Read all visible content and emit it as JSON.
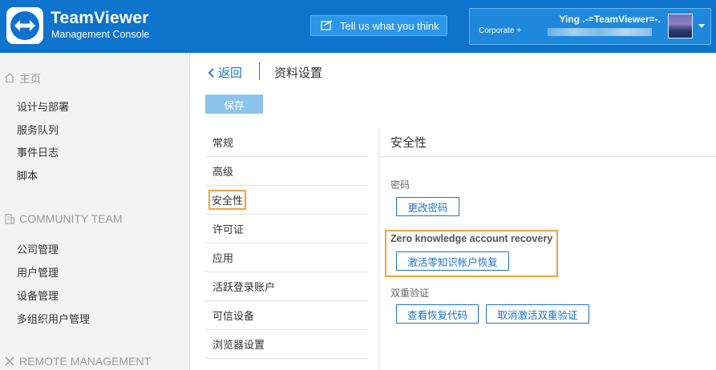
{
  "header": {
    "brand_name": "TeamViewer",
    "brand_sub": "Management Console",
    "feedback_label": "Tell us what you think",
    "user_name": "Ying .-=TeamViewer=-.",
    "user_org": "Corporate +"
  },
  "sidebar": {
    "home_title": "主页",
    "home_items": [
      "设计与部署",
      "服务队列",
      "事件日志",
      "脚本"
    ],
    "team_title": "COMMUNITY TEAM",
    "team_items": [
      "公司管理",
      "用户管理",
      "设备管理",
      "多组织用户管理"
    ],
    "remote_title": "REMOTE MANAGEMENT"
  },
  "main": {
    "back_label": "返回",
    "page_title": "资料设置",
    "save_label": "保存",
    "sub_nav": [
      "常规",
      "高级",
      "安全性",
      "许可证",
      "应用",
      "活跃登录账户",
      "可信设备",
      "浏览器设置"
    ],
    "active_index": 2,
    "security": {
      "heading": "安全性",
      "password_label": "密码",
      "change_password": "更改密码",
      "zk_label": "Zero knowledge account recovery",
      "zk_button": "激活零知识帐户恢复",
      "twofa_label": "双重验证",
      "view_codes": "查看恢复代码",
      "deactivate_2fa": "取消激活双重验证"
    }
  },
  "colors": {
    "header_bg": "#0e73cc",
    "accent": "#1a73c8",
    "highlight": "#f5a23a"
  }
}
